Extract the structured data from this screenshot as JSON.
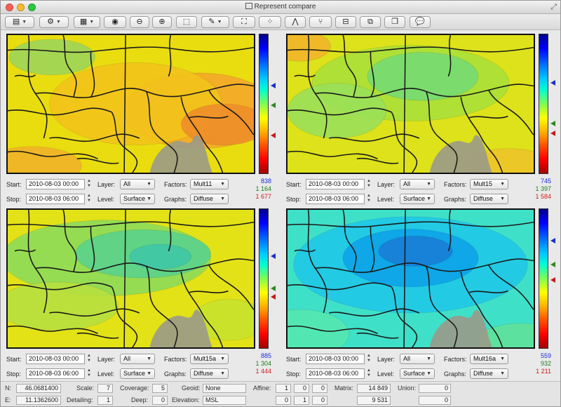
{
  "window": {
    "title": "Represent compare"
  },
  "panels": [
    {
      "start": "2010-08-03 00:00",
      "stop": "2010-08-03 06:00",
      "layer": "All",
      "level": "Surface",
      "factors": "Mult11",
      "graphs": "Diffuse",
      "values": [
        "838",
        "1 164",
        "1 677"
      ]
    },
    {
      "start": "2010-08-03 00:00",
      "stop": "2010-08-03 06:00",
      "layer": "All",
      "level": "Surface",
      "factors": "Mult15",
      "graphs": "Diffuse",
      "values": [
        "745",
        "1 397",
        "1 584"
      ]
    },
    {
      "start": "2010-08-03 00:00",
      "stop": "2010-08-03 06:00",
      "layer": "All",
      "level": "Surface",
      "factors": "Mult15a",
      "graphs": "Diffuse",
      "values": [
        "885",
        "1 304",
        "1 444"
      ]
    },
    {
      "start": "2010-08-03 00:00",
      "stop": "2010-08-03 06:00",
      "layer": "All",
      "level": "Surface",
      "factors": "Mult16a",
      "graphs": "Diffuse",
      "values": [
        "559",
        "932",
        "1 211"
      ]
    }
  ],
  "labels": {
    "start": "Start:",
    "stop": "Stop:",
    "layer": "Layer:",
    "level": "Level:",
    "factors": "Factors:",
    "graphs": "Graphs:"
  },
  "status": {
    "n_label": "N:",
    "n_value": "46.0681400",
    "e_label": "E:",
    "e_value": "11.1362600",
    "scale_label": "Scale:",
    "scale_value": "7",
    "detailing_label": "Detailing:",
    "detailing_value": "1",
    "coverage_label": "Coverage:",
    "coverage_value": "5",
    "deep_label": "Deep:",
    "deep_value": "0",
    "geoid_label": "Geoid:",
    "geoid_value": "None",
    "elevation_label": "Elevation:",
    "elevation_value": "MSL",
    "affine_label": "Affine:",
    "affine_row1": [
      "1",
      "0",
      "0"
    ],
    "affine_row2": [
      "0",
      "1",
      "0"
    ],
    "matrix_label": "Matrix:",
    "matrix_row1": "14 849",
    "matrix_row2": "9 531",
    "union_label": "Union:",
    "union_row1": "0",
    "union_row2": "0"
  },
  "colors": {
    "value_blue": "#1c2cd8",
    "value_green": "#1f7f1f",
    "value_red": "#d21c1c",
    "marker_blue": "#1a2fd0",
    "marker_green": "#2b8a1c",
    "marker_red": "#c81818"
  },
  "icons": [
    "panel-toggle-icon",
    "gear-icon",
    "grid-icon",
    "eye-icon",
    "zoom-out-icon",
    "zoom-in-icon",
    "selection-icon",
    "pencil-icon",
    "transform-icon",
    "nodes-icon",
    "branch-icon",
    "filter-icon",
    "window-icon",
    "copy-icon",
    "comment-icon"
  ]
}
